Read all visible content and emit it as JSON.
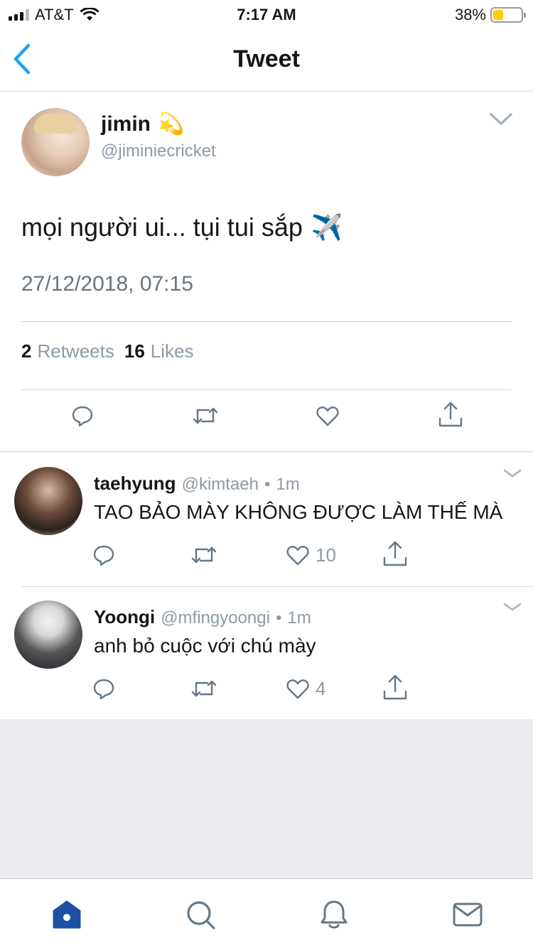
{
  "status_bar": {
    "carrier": "AT&T",
    "time": "7:17 AM",
    "battery_percent_label": "38%",
    "battery_level": 0.38
  },
  "nav": {
    "title": "Tweet",
    "back_icon": "chevron-left-icon"
  },
  "main_tweet": {
    "author_name": "jimin",
    "author_emoji": "💫",
    "author_handle": "@jiminiecricket",
    "text": "mọi người ui... tụi tui sắp",
    "text_emoji": "✈️",
    "timestamp": "27/12/2018, 07:15",
    "retweet_count": "2",
    "retweet_label": "Retweets",
    "like_count": "16",
    "like_label": "Likes",
    "actions": [
      "reply-icon",
      "retweet-icon",
      "like-icon",
      "share-icon"
    ]
  },
  "replies": [
    {
      "name": "taehyung",
      "handle": "@kimtaeh",
      "separator": "•",
      "time": "1m",
      "text": "TAO BẢO MÀY KHÔNG ĐƯỢC LÀM THẾ MÀ",
      "like_count": "10"
    },
    {
      "name": "Yoongi",
      "handle": "@mfingyoongi",
      "separator": "•",
      "time": "1m",
      "text": "anh bỏ cuộc với chú mày",
      "like_count": "4"
    }
  ],
  "tab_bar": {
    "tabs": [
      "home-icon",
      "search-icon",
      "notifications-icon",
      "messages-icon"
    ],
    "active": "home-icon"
  },
  "colors": {
    "accent": "#1da1f2",
    "home_active": "#1d4fa3",
    "muted_text": "#8e9aa5",
    "battery_fill": "#ffcc00",
    "background": "#ebebf0"
  }
}
